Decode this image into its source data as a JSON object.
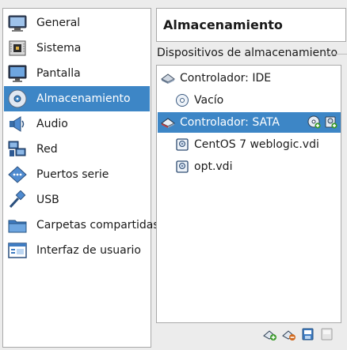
{
  "sidebar": {
    "items": [
      {
        "label": "General",
        "icon": "general-icon"
      },
      {
        "label": "Sistema",
        "icon": "system-chip-icon"
      },
      {
        "label": "Pantalla",
        "icon": "display-monitor-icon"
      },
      {
        "label": "Almacenamiento",
        "icon": "storage-disk-icon",
        "selected": true
      },
      {
        "label": "Audio",
        "icon": "speaker-icon"
      },
      {
        "label": "Red",
        "icon": "network-icon"
      },
      {
        "label": "Puertos serie",
        "icon": "serial-port-icon"
      },
      {
        "label": "USB",
        "icon": "usb-icon"
      },
      {
        "label": "Carpetas compartidas",
        "icon": "shared-folder-icon"
      },
      {
        "label": "Interfaz de usuario",
        "icon": "user-interface-icon"
      }
    ]
  },
  "header": {
    "title": "Almacenamiento"
  },
  "storage": {
    "section_title": "Dispositivos de almacenamiento",
    "tree": [
      {
        "label": "Controlador: IDE",
        "icon": "ide-controller-icon",
        "level": 0
      },
      {
        "label": "Vacío",
        "icon": "optical-disc-icon",
        "level": 1
      },
      {
        "label": "Controlador: SATA",
        "icon": "sata-controller-icon",
        "level": 0,
        "selected": true
      },
      {
        "label": "CentOS 7 weblogic.vdi",
        "icon": "hard-disk-icon",
        "level": 1
      },
      {
        "label": "opt.vdi",
        "icon": "hard-disk-icon",
        "level": 1
      }
    ]
  },
  "colors": {
    "selection": "#3d86c6",
    "panel_bg": "#ececec",
    "list_bg": "#ffffff",
    "border": "#a9a9a9",
    "add_green": "#3a9a2a"
  }
}
